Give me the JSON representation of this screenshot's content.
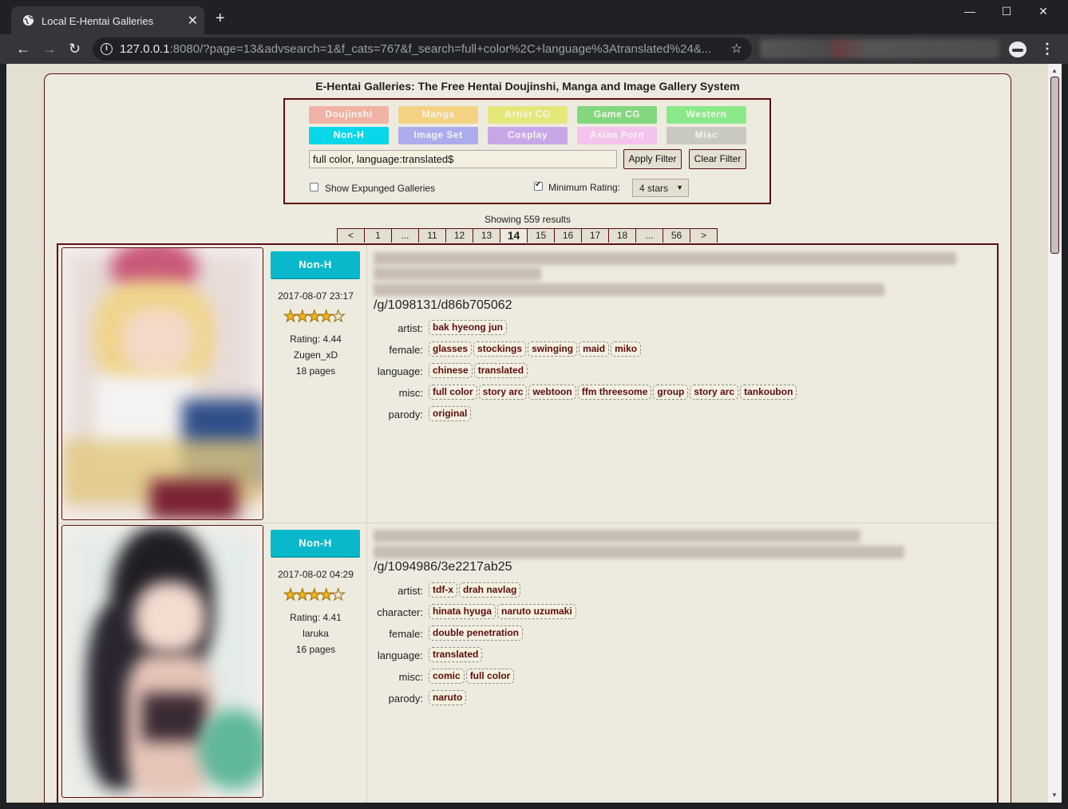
{
  "browser": {
    "tab_title": "Local E-Hentai Galleries",
    "tab_close": "✕",
    "new_tab": "+",
    "url_host": "127.0.0.1",
    "url_rest": ":8080/?page=13&advsearch=1&f_cats=767&f_search=full+color%2C+language%3Atranslated%24&...",
    "win_min": "—",
    "win_max": "☐",
    "win_close": "✕"
  },
  "page": {
    "heading": "E-Hentai Galleries: The Free Hentai Doujinshi, Manga and Image Gallery System",
    "categories": [
      {
        "label": "Doujinshi",
        "color": "#f26f5f",
        "enabled": false
      },
      {
        "label": "Manga",
        "color": "#fcb417",
        "enabled": false
      },
      {
        "label": "Artist CG",
        "color": "#dde500",
        "enabled": false
      },
      {
        "label": "Game CG",
        "color": "#05bf0b",
        "enabled": false
      },
      {
        "label": "Western",
        "color": "#14e723",
        "enabled": false
      },
      {
        "label": "Non-H",
        "color": "#08d7e9",
        "enabled": true
      },
      {
        "label": "Image Set",
        "color": "#5f5fff",
        "enabled": false
      },
      {
        "label": "Cosplay",
        "color": "#9755f5",
        "enabled": false
      },
      {
        "label": "Asian Porn",
        "color": "#fe93ff",
        "enabled": false
      },
      {
        "label": "Misc",
        "color": "#9e9e9e",
        "enabled": false
      }
    ],
    "search_value": "full color, language:translated$",
    "apply_filter": "Apply Filter",
    "clear_filter": "Clear Filter",
    "show_expunged": "Show Expunged Galleries",
    "show_expunged_checked": false,
    "min_rating_label": "Minimum Rating:",
    "min_rating_checked": true,
    "min_rating_value": "4 stars",
    "showing": "Showing 559 results",
    "pager": [
      "<",
      "1",
      "...",
      "11",
      "12",
      "13",
      "14",
      "15",
      "16",
      "17",
      "18",
      "...",
      "56",
      ">"
    ],
    "current_page": "14"
  },
  "galleries": [
    {
      "category": "Non-H",
      "posted": "2017-08-07 23:17",
      "rating": "Rating: 4.44",
      "uploader": "Zugen_xD",
      "pages": "18 pages",
      "link": "/g/1098131/d86b705062",
      "tags": [
        {
          "ns": "artist:",
          "values": [
            "bak hyeong jun"
          ]
        },
        {
          "ns": "female:",
          "values": [
            "glasses",
            "stockings",
            "swinging",
            "maid",
            "miko"
          ]
        },
        {
          "ns": "language:",
          "values": [
            "chinese",
            "translated"
          ]
        },
        {
          "ns": "misc:",
          "values": [
            "full color",
            "story arc",
            "webtoon",
            "ffm threesome",
            "group",
            "story arc",
            "tankoubon"
          ]
        },
        {
          "ns": "parody:",
          "values": [
            "original"
          ]
        }
      ]
    },
    {
      "category": "Non-H",
      "posted": "2017-08-02 04:29",
      "rating": "Rating: 4.41",
      "uploader": "laruka",
      "pages": "16 pages",
      "link": "/g/1094986/3e2217ab25",
      "tags": [
        {
          "ns": "artist:",
          "values": [
            "tdf-x",
            "drah navlag"
          ]
        },
        {
          "ns": "character:",
          "values": [
            "hinata hyuga",
            "naruto uzumaki"
          ]
        },
        {
          "ns": "female:",
          "values": [
            "double penetration"
          ]
        },
        {
          "ns": "language:",
          "values": [
            "translated"
          ]
        },
        {
          "ns": "misc:",
          "values": [
            "comic",
            "full color"
          ]
        },
        {
          "ns": "parody:",
          "values": [
            "naruto"
          ]
        }
      ]
    }
  ]
}
